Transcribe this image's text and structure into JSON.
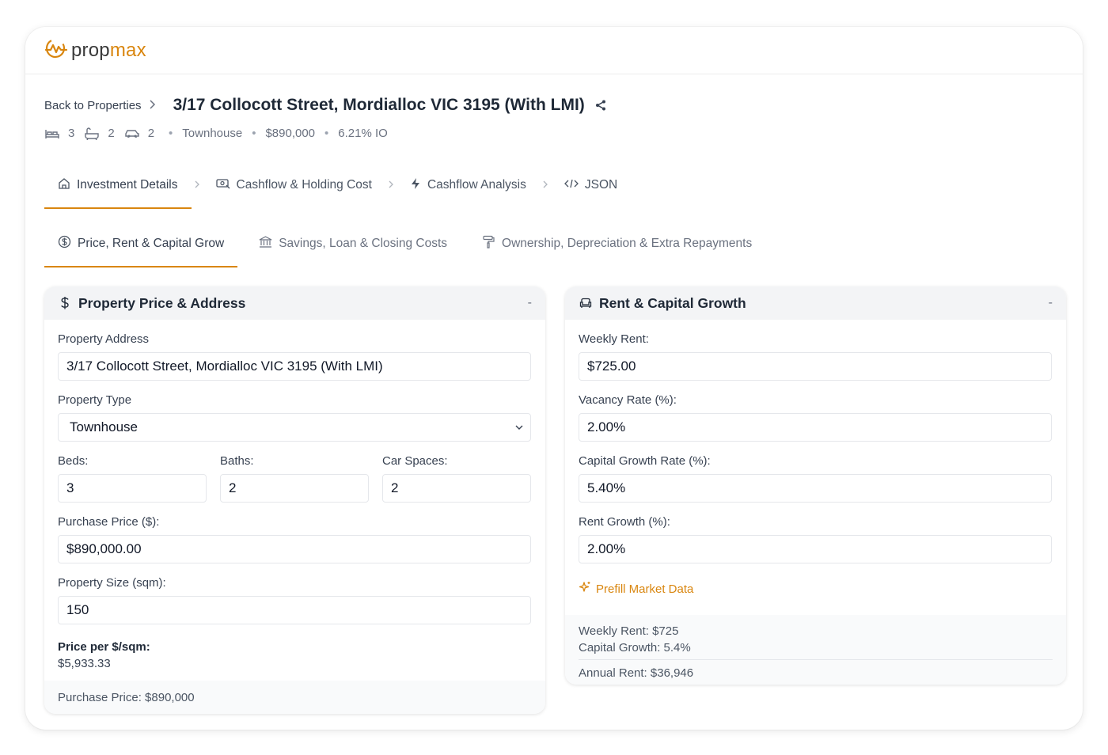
{
  "app": {
    "brand_prop": "prop",
    "brand_max": "max",
    "accent_color": "#d9860f"
  },
  "header": {
    "back_label": "Back to Properties",
    "title": "3/17 Collocott Street, Mordialloc VIC 3195 (With LMI)"
  },
  "meta": {
    "beds": "3",
    "baths": "2",
    "cars": "2",
    "type": "Townhouse",
    "price": "$890,000",
    "rate": "6.21% IO"
  },
  "tabs": [
    {
      "label": "Investment Details",
      "icon": "home-icon"
    },
    {
      "label": "Cashflow & Holding Cost",
      "icon": "cash-icon"
    },
    {
      "label": "Cashflow Analysis",
      "icon": "bolt-icon"
    },
    {
      "label": "JSON",
      "icon": "code-icon"
    }
  ],
  "subtabs": [
    {
      "label": "Price, Rent & Capital Grow",
      "icon": "dollar-circle-icon"
    },
    {
      "label": "Savings, Loan & Closing Costs",
      "icon": "bank-icon"
    },
    {
      "label": "Ownership, Depreciation & Extra Repayments",
      "icon": "paint-roller-icon"
    }
  ],
  "left_card": {
    "title": "Property Price & Address",
    "collapse": "-",
    "address_label": "Property Address",
    "address_value": "3/17 Collocott Street, Mordialloc VIC 3195 (With LMI)",
    "type_label": "Property Type",
    "type_value": "Townhouse",
    "beds_label": "Beds:",
    "beds_value": "3",
    "baths_label": "Baths:",
    "baths_value": "2",
    "cars_label": "Car Spaces:",
    "cars_value": "2",
    "price_label": "Purchase Price ($):",
    "price_value": "$890,000.00",
    "size_label": "Property Size (sqm):",
    "size_value": "150",
    "ppsqm_label": "Price per $/sqm:",
    "ppsqm_value": "$5,933.33",
    "footer": "Purchase Price: $890,000"
  },
  "right_card": {
    "title": "Rent & Capital Growth",
    "collapse": "-",
    "rent_label": "Weekly Rent:",
    "rent_value": "$725.00",
    "vacancy_label": "Vacancy Rate (%):",
    "vacancy_value": "2.00%",
    "growth_label": "Capital Growth Rate (%):",
    "growth_value": "5.40%",
    "rent_growth_label": "Rent Growth (%):",
    "rent_growth_value": "2.00%",
    "prefill_label": "Prefill Market Data",
    "footer_line1": "Weekly Rent: $725",
    "footer_line2": "Capital Growth: 5.4%",
    "footer_line3": "Annual Rent: $36,946"
  }
}
